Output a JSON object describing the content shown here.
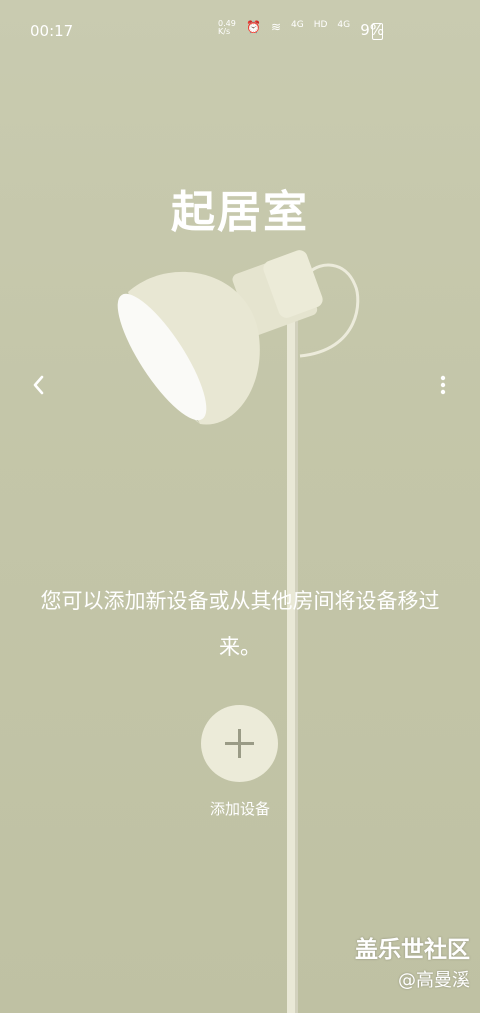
{
  "status_bar": {
    "time": "00:17",
    "net_speed": "0.49 K/s",
    "signal_a": "4G",
    "hd": "HD",
    "signal_b": "4G",
    "battery": "9%"
  },
  "room": {
    "title": "起居室"
  },
  "empty_state": {
    "message": "您可以添加新设备或从其他房间将设备移过来。",
    "add_label": "添加设备"
  },
  "watermark": {
    "forum": "盖乐世社区",
    "user": "@高曼溪"
  }
}
